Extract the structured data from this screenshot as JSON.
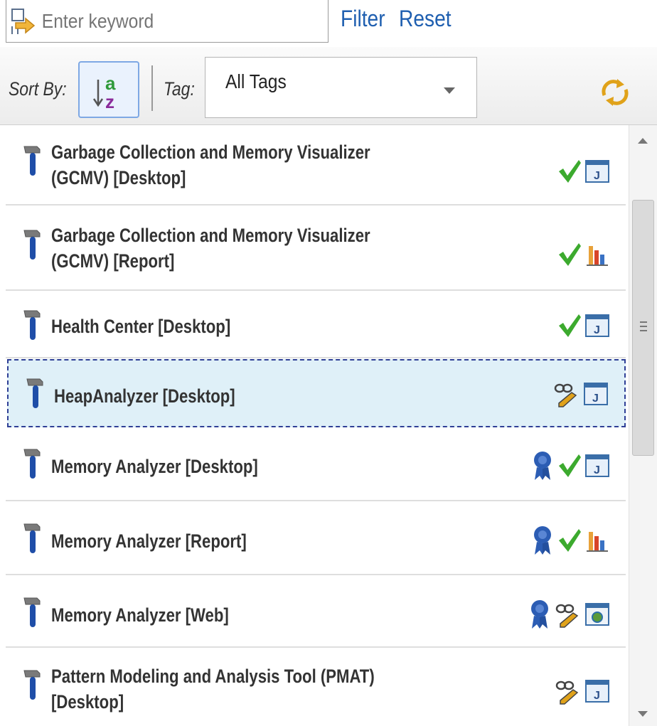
{
  "search": {
    "placeholder": "Enter keyword",
    "value": ""
  },
  "actions": {
    "filter_label": "Filter",
    "reset_label": "Reset"
  },
  "toolbar": {
    "sort_by_label": "Sort By:",
    "sort_icon": "sort-alpha-asc-icon",
    "tag_label": "Tag:",
    "tag_selected": "All Tags",
    "refresh_icon": "refresh-icon"
  },
  "colors": {
    "link": "#1f5fb0",
    "selected_row_bg": "#dff0f8",
    "selected_row_border": "#2f3f96",
    "check": "#3caa2e",
    "hammer_handle": "#1f4ea8"
  },
  "tools": {
    "items": [
      {
        "name_line1": "Garbage Collection and Memory Visualizer",
        "name_line2": "(GCMV) [Desktop]",
        "icons": [
          "installed-check-icon",
          "java-app-icon"
        ]
      },
      {
        "name_line1": "Garbage Collection and Memory Visualizer",
        "name_line2": "(GCMV) [Report]",
        "icons": [
          "installed-check-icon",
          "bar-chart-report-icon"
        ]
      },
      {
        "name_line1": "Health Center [Desktop]",
        "name_line2": "",
        "icons": [
          "installed-check-icon",
          "java-app-icon"
        ]
      },
      {
        "name_line1": "HeapAnalyzer [Desktop]",
        "name_line2": "",
        "icons": [
          "link-edit-icon",
          "java-app-icon"
        ],
        "selected": true
      },
      {
        "name_line1": "Memory Analyzer [Desktop]",
        "name_line2": "",
        "icons": [
          "award-ribbon-icon",
          "installed-check-icon",
          "java-app-icon"
        ]
      },
      {
        "name_line1": "Memory Analyzer [Report]",
        "name_line2": "",
        "icons": [
          "award-ribbon-icon",
          "installed-check-icon",
          "bar-chart-report-icon"
        ]
      },
      {
        "name_line1": "Memory Analyzer [Web]",
        "name_line2": "",
        "icons": [
          "award-ribbon-icon",
          "link-edit-icon",
          "web-app-icon"
        ]
      },
      {
        "name_line1": "Pattern Modeling and Analysis Tool (PMAT)",
        "name_line2": "[Desktop]",
        "icons": [
          "link-edit-icon",
          "java-app-icon"
        ]
      }
    ]
  }
}
